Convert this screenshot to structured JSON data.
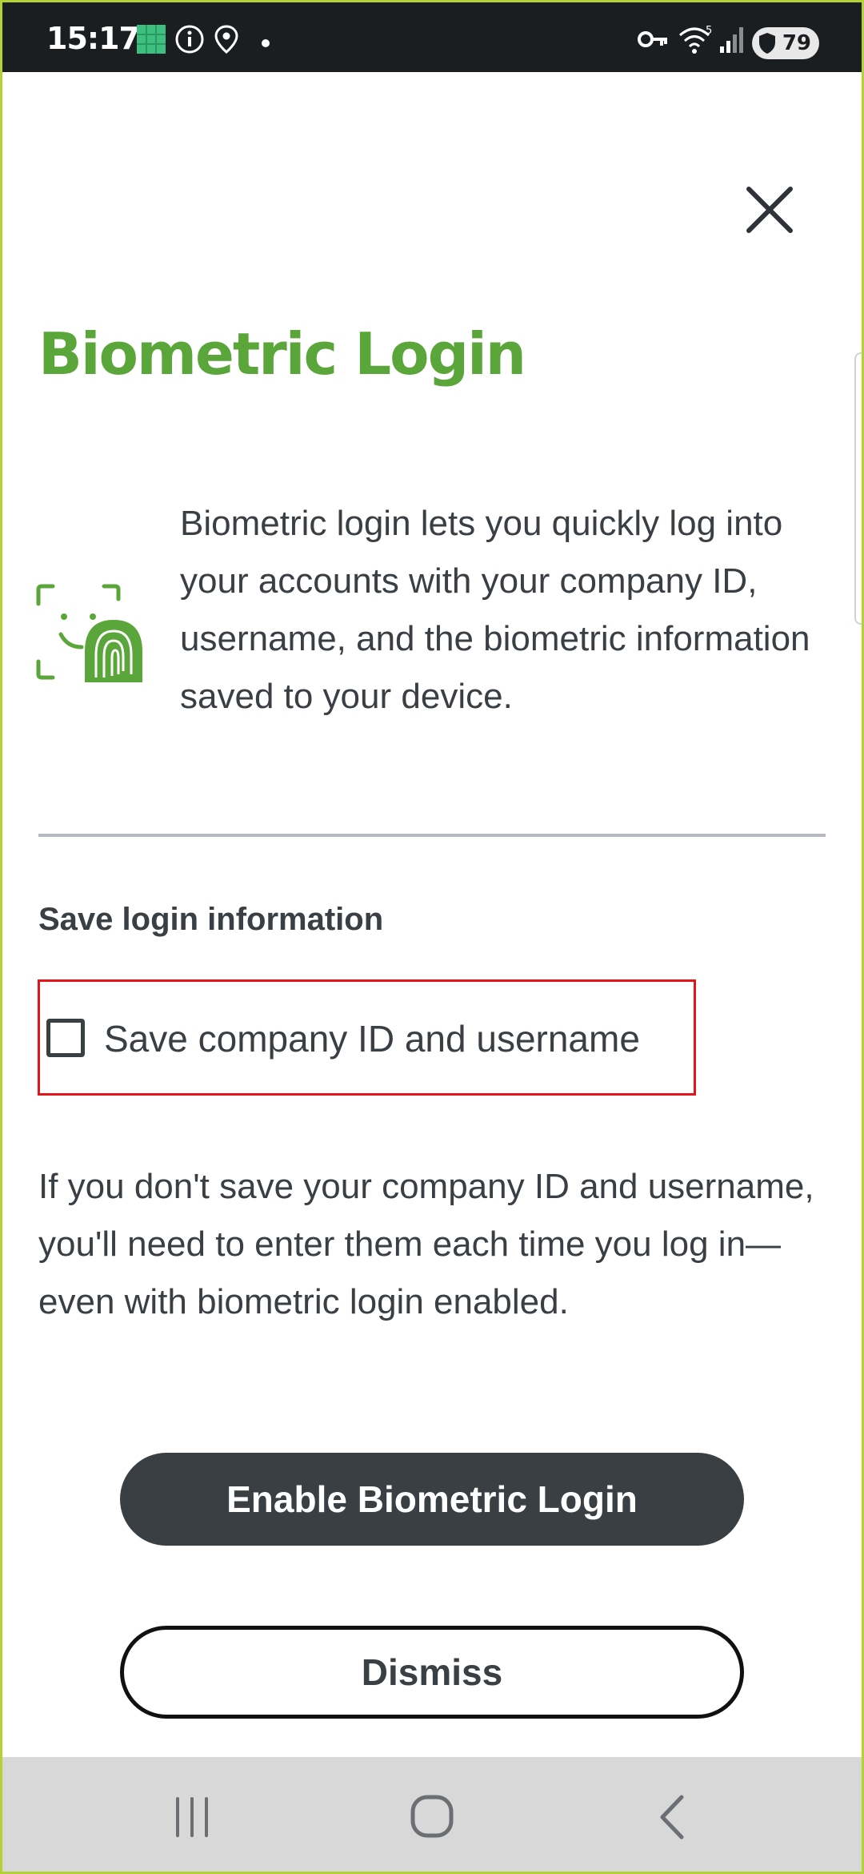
{
  "status_bar": {
    "time": "15:17",
    "battery": "79",
    "icons": [
      "gallery-icon",
      "info-icon",
      "location-icon",
      "dot-icon",
      "vpn-key-icon",
      "wifi-icon",
      "signal-icon",
      "battery-icon"
    ]
  },
  "dialog": {
    "title": "Biometric Login",
    "intro": "Biometric login lets you quickly log into your accounts with your company ID, username, and the biometric information saved to your device.",
    "section_heading": "Save login information",
    "checkbox_label": "Save company ID and username",
    "checkbox_checked": false,
    "note": "If you don't save your company ID and username, you'll need to enter them each time you log in—even with biometric login enabled.",
    "primary_button": "Enable Biometric Login",
    "secondary_button": "Dismiss"
  },
  "colors": {
    "brand_green": "#5ba63a",
    "text": "#3a3f44",
    "button_dark": "#3a3f44",
    "highlight_red": "#e3151a"
  },
  "nav_bar": {
    "buttons": [
      "recent-apps",
      "home",
      "back"
    ]
  }
}
